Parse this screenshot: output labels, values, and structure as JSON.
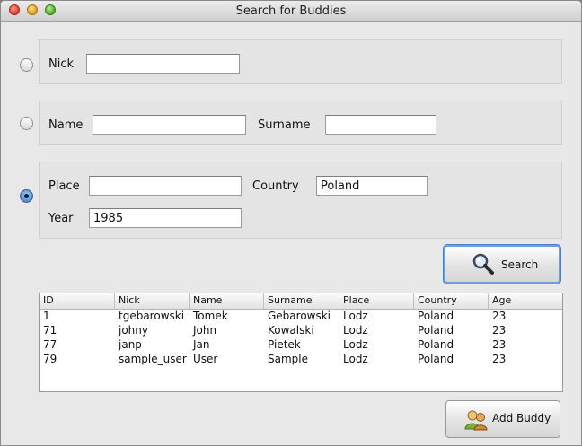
{
  "window": {
    "title": "Search for Buddies"
  },
  "by_nick": {
    "label": "Nick",
    "value": ""
  },
  "by_name": {
    "name_label": "Name",
    "name_value": "",
    "surname_label": "Surname",
    "surname_value": ""
  },
  "by_location": {
    "place_label": "Place",
    "place_value": "",
    "country_label": "Country",
    "country_value": "Poland",
    "year_label": "Year",
    "year_value": "1985"
  },
  "search_button": {
    "label": "Search",
    "icon": "magnifier-icon"
  },
  "results": {
    "columns": [
      "ID",
      "Nick",
      "Name",
      "Surname",
      "Place",
      "Country",
      "Age"
    ],
    "rows": [
      [
        "1",
        "tgebarowski",
        "Tomek",
        "Gebarowski",
        "Lodz",
        "Poland",
        "23"
      ],
      [
        "71",
        "johny",
        "John",
        "Kowalski",
        "Lodz",
        "Poland",
        "23"
      ],
      [
        "77",
        "janp",
        "Jan",
        "Pietek",
        "Lodz",
        "Poland",
        "23"
      ],
      [
        "79",
        "sample_user",
        "User",
        "Sample",
        "Lodz",
        "Poland",
        "23"
      ]
    ]
  },
  "add_buddy_button": {
    "label": "Add Buddy",
    "icon": "buddies-icon"
  }
}
